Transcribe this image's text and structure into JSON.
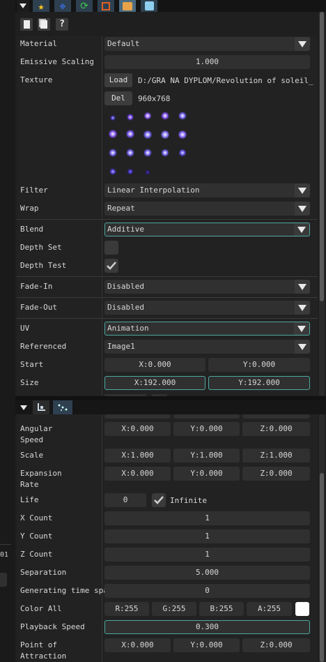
{
  "colors": {
    "accent": "#4fa8a0",
    "panel": "#1f1f1f",
    "field": "#303030"
  },
  "top_toolbar": {
    "icons": [
      "menu-triangle-icon",
      "star-icon",
      "move-arrows-icon",
      "rotate-icon",
      "scale-icon",
      "box-icon",
      "cube-icon"
    ]
  },
  "file_toolbar": {
    "icons": [
      "copy-icon",
      "paste-icon",
      "help-icon"
    ],
    "help_label": "?"
  },
  "upper_panel": {
    "material": {
      "label": "Material",
      "value": "Default"
    },
    "emissive": {
      "label": "Emissive Scaling",
      "value": "1.000"
    },
    "texture": {
      "label": "Texture",
      "load": "Load",
      "path": "D:/GRA NA DYPLOM/Revolution of soleil_repo/r",
      "del": "Del",
      "size": "960x768"
    },
    "filter": {
      "label": "Filter",
      "value": "Linear Interpolation"
    },
    "wrap": {
      "label": "Wrap",
      "value": "Repeat"
    },
    "blend": {
      "label": "Blend",
      "value": "Additive"
    },
    "depth_set": {
      "label": "Depth Set"
    },
    "depth_test": {
      "label": "Depth Test"
    },
    "fade_in": {
      "label": "Fade-In",
      "value": "Disabled"
    },
    "fade_out": {
      "label": "Fade-Out",
      "value": "Disabled"
    },
    "uv": {
      "label": "UV",
      "value": "Animation"
    },
    "referenced": {
      "label": "Referenced",
      "value": "Image1"
    },
    "start": {
      "label": "Start",
      "x": "X:0.000",
      "y": "Y:0.000"
    },
    "size": {
      "label": "Size",
      "x": "X:192.000",
      "y": "Y:192.000"
    }
  },
  "lower_tabs": [
    "menu-triangle-icon",
    "transform-icon",
    "particles-icon"
  ],
  "lower_panel": {
    "top_partial": {
      "x": "",
      "y": "",
      "z": ""
    },
    "angular_speed": {
      "label1": "Angular",
      "label2": "Speed",
      "x": "X:0.000",
      "y": "Y:0.000",
      "z": "Z:0.000"
    },
    "scale": {
      "label": "Scale",
      "x": "X:1.000",
      "y": "Y:1.000",
      "z": "Z:1.000"
    },
    "expansion_rate": {
      "label1": "Expansion",
      "label2": "Rate",
      "x": "X:0.000",
      "y": "Y:0.000",
      "z": "Z:0.000"
    },
    "life": {
      "label": "Life",
      "value": "0",
      "infinite": "Infinite"
    },
    "x_count": {
      "label": "X Count",
      "value": "1"
    },
    "y_count": {
      "label": "Y Count",
      "value": "1"
    },
    "z_count": {
      "label": "Z Count",
      "value": "1"
    },
    "separation": {
      "label": "Separation",
      "value": "5.000"
    },
    "gen_time": {
      "label": "Generating time span",
      "value": "0"
    },
    "color_all": {
      "label": "Color All",
      "r": "R:255",
      "g": "G:255",
      "b": "B:255",
      "a": "A:255"
    },
    "playback": {
      "label": "Playback Speed",
      "value": "0.300"
    },
    "attraction": {
      "label1": "Point of",
      "label2": "Attraction",
      "x": "X:0.000",
      "y": "Y:0.000",
      "z": "Z:0.000"
    }
  },
  "left_edge": {
    "fragment": "01"
  }
}
